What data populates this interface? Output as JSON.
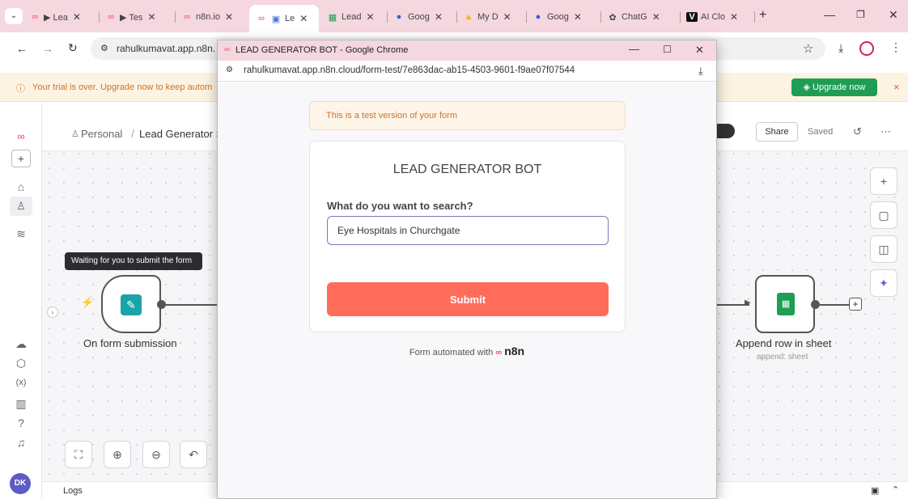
{
  "browser": {
    "tabs": [
      {
        "label": "▶ Lea",
        "icon": "n8n-icon"
      },
      {
        "label": "▶ Tes",
        "icon": "n8n-icon"
      },
      {
        "label": "n8n.io",
        "icon": "n8n-icon"
      },
      {
        "label": "Le",
        "icon": "n8n-icon"
      },
      {
        "label": "Lead",
        "icon": "sheets-icon"
      },
      {
        "label": "Goog",
        "icon": "search-icon"
      },
      {
        "label": "My D",
        "icon": "drive-icon"
      },
      {
        "label": "Goog",
        "icon": "search-icon"
      },
      {
        "label": "ChatG",
        "icon": "chatgpt-icon"
      },
      {
        "label": "AI Clo",
        "icon": "v-icon"
      }
    ],
    "url": "rahulkumavat.app.n8n."
  },
  "banner": {
    "text": "Your trial is over. Upgrade now to keep autom",
    "upgrade_label": "Upgrade now",
    "close": "×"
  },
  "app": {
    "breadcrumb_owner": "Personal",
    "breadcrumb_sep": "/",
    "workflow_name": "Lead Generator S",
    "share_label": "Share",
    "saved_label": "Saved",
    "logs_label": "Logs",
    "tooltip": "Waiting for you to submit the form",
    "nodes": [
      {
        "title": "On form submission",
        "subtitle": ""
      },
      {
        "title": "Append row in sheet",
        "subtitle": "append: sheet"
      }
    ]
  },
  "popup": {
    "window_title": "LEAD GENERATOR BOT - Google Chrome",
    "url": "rahulkumavat.app.n8n.cloud/form-test/7e863dac-ab15-4503-9601-f9ae07f07544",
    "notice": "This is a test version of your form",
    "form_title": "LEAD GENERATOR BOT",
    "question": "What do you want to search?",
    "answer": "Eye Hospitals in Churchgate",
    "submit_label": "Submit",
    "footer_prefix": "Form automated with",
    "footer_brand": "n8n"
  },
  "colors": {
    "accent": "#ff6d5a",
    "upgrade": "#1db954",
    "tab_strip": "#f5d7df"
  }
}
